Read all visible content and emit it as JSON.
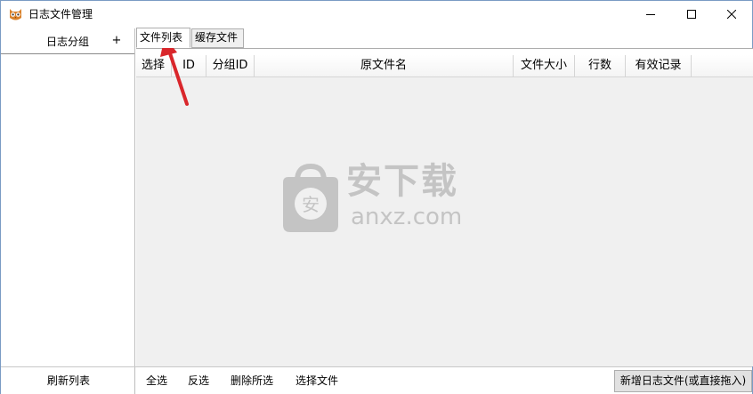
{
  "window": {
    "title": "日志文件管理",
    "icon": "owl-app-icon",
    "controls": [
      "minimize-icon",
      "maximize-icon",
      "close-icon"
    ]
  },
  "left_panel": {
    "title": "日志分组",
    "add_label": "+"
  },
  "tabs": [
    {
      "label": "文件列表",
      "active": true
    },
    {
      "label": "缓存文件",
      "active": false
    }
  ],
  "table": {
    "columns": [
      "选择",
      "ID",
      "分组ID",
      "原文件名",
      "文件大小",
      "行数",
      "有效记录"
    ],
    "rows": []
  },
  "watermark": {
    "cn": "安下载",
    "en": "anxz.com",
    "bag_glyph": "安"
  },
  "bottom": {
    "refresh_label": "刷新列表",
    "select_all_label": "全选",
    "invert_label": "反选",
    "delete_label": "删除所选",
    "choose_file_label": "选择文件",
    "add_log_label": "新增日志文件(或直接拖入)"
  },
  "colors": {
    "annotation_arrow": "#d9262b",
    "window_border": "#7a9bc4",
    "grid_background": "#f0f0f0",
    "watermark": "#c4c4c4"
  }
}
